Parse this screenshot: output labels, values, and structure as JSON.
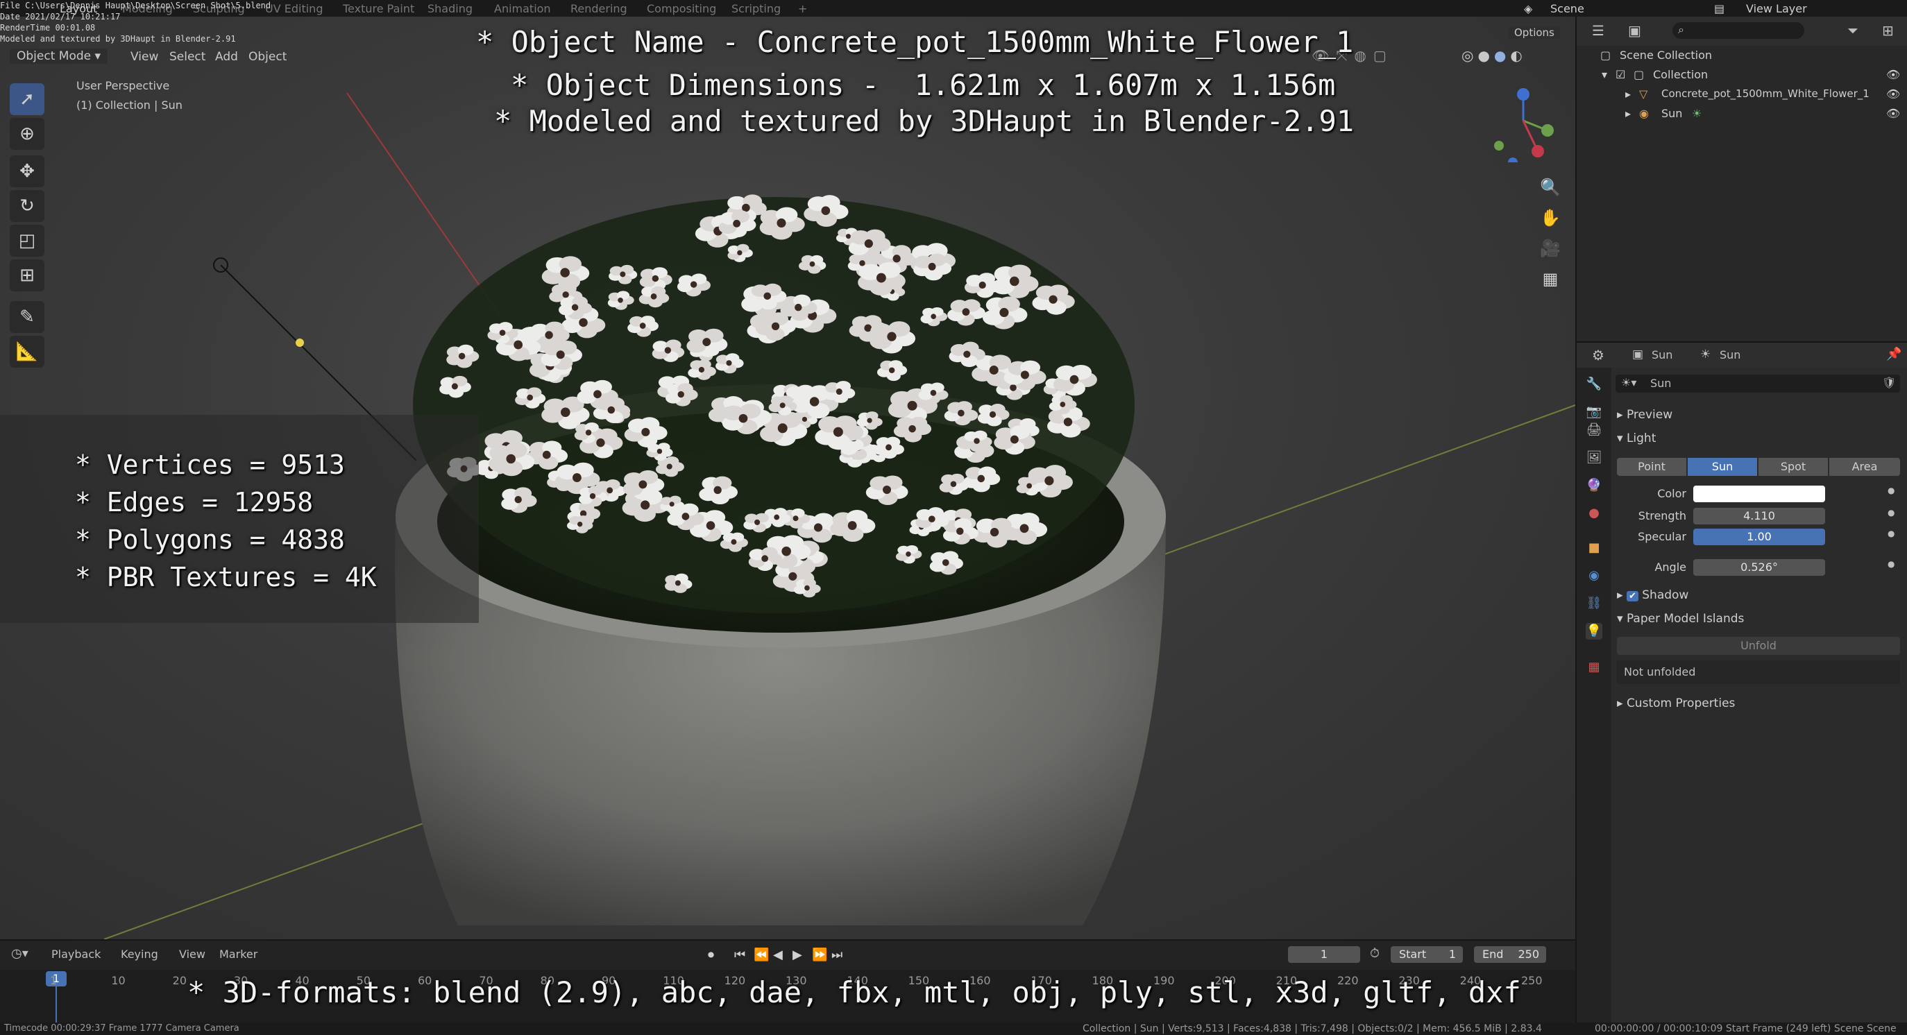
{
  "topbar": {
    "menu": "File",
    "workspaces": [
      "Layout",
      "Modeling",
      "Sculpting",
      "UV Editing",
      "Texture Paint",
      "Shading",
      "Animation",
      "Rendering",
      "Compositing",
      "Scripting"
    ],
    "active_workspace": "Layout",
    "scene": "Scene",
    "view_layer": "View Layer"
  },
  "overlay_info": {
    "file": "File C:\\Users\\Dennis Haupt\\Desktop\\Screen Shot\\5.blend",
    "date": "Date 2021/02/17 10:21:17",
    "render_time": "RenderTime 00:01.08",
    "credit": "Modeled and textured by 3DHaupt in Blender-2.91"
  },
  "viewport": {
    "mode": "Object Mode",
    "menus": [
      "View",
      "Select",
      "Add",
      "Object"
    ],
    "perspective": "User Perspective",
    "collection": "(1) Collection | Sun",
    "options": "Options"
  },
  "overlay_text": {
    "line1": "* Object Name - Concrete_pot_1500mm_White_Flower_1",
    "line2": "* Object Dimensions -  1.621m x 1.607m x 1.156m",
    "line3": "* Modeled and textured by 3DHaupt in Blender-2.91",
    "stats": [
      "* Vertices = 9513",
      "* Edges = 12958",
      "* Polygons = 4838",
      "* PBR Textures = 4K"
    ],
    "formats": "* 3D-formats: blend (2.9), abc, dae, fbx, mtl, obj, ply, stl, x3d, gltf, dxf"
  },
  "outliner": {
    "root": "Scene Collection",
    "collection": "Collection",
    "object": "Concrete_pot_1500mm_White_Flower_1",
    "light": "Sun"
  },
  "properties": {
    "breadcrumb_object": "Sun",
    "breadcrumb_data": "Sun",
    "datablock": "Sun",
    "preview": "Preview",
    "light": "Light",
    "light_types": [
      "Point",
      "Sun",
      "Spot",
      "Area"
    ],
    "active_type": "Sun",
    "color_label": "Color",
    "strength_label": "Strength",
    "strength": "4.110",
    "specular_label": "Specular",
    "specular": "1.00",
    "angle_label": "Angle",
    "angle": "0.526°",
    "shadow": "Shadow",
    "paper_model": "Paper Model Islands",
    "unfold": "Unfold",
    "not_unfolded": "Not unfolded",
    "custom_props": "Custom Properties",
    "accent": "#4772b3"
  },
  "timeline": {
    "menus": [
      "Playback",
      "Keying",
      "View",
      "Marker"
    ],
    "current_frame": "1",
    "start_label": "Start",
    "start": "1",
    "end_label": "End",
    "end": "250",
    "ticks": [
      "1",
      "10",
      "20",
      "30",
      "40",
      "50",
      "60",
      "70",
      "80",
      "90",
      "110",
      "120",
      "130",
      "140",
      "150",
      "160",
      "170",
      "180",
      "190",
      "200",
      "210",
      "220",
      "230",
      "240",
      "250"
    ]
  },
  "statusbar": {
    "left": "Timecode 00:00:29:37   Frame 1777   Camera Camera",
    "center": "Collection | Sun | Verts:9,513 | Faces:4,838 | Tris:7,498 | Objects:0/2 | Mem: 456.5 MiB | 2.83.4",
    "right": "00:00:00:00 / 00:00:10:09     Start Frame (249 left)  Scene Scene"
  }
}
